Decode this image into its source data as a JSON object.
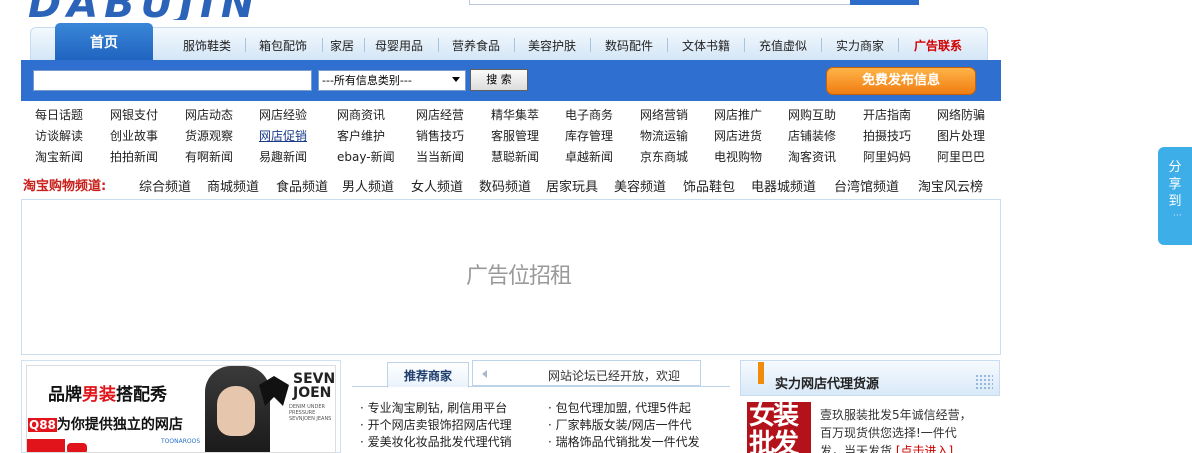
{
  "header": {
    "logo_text": "DABUJIN"
  },
  "nav": {
    "home": "首页",
    "items": [
      "服饰鞋类",
      "箱包配饰",
      "家居",
      "母婴用品",
      "营养食品",
      "美容护肤",
      "数码配件",
      "文体书籍",
      "充值虚似",
      "实力商家"
    ],
    "ad_contact": "广告联系"
  },
  "search": {
    "keyword_value": "",
    "category_selected": "---所有信息类别---",
    "button_label": "搜 索",
    "publish_label": "免费发布信息"
  },
  "link_grid": [
    [
      "每日话题",
      "网银支付",
      "网店动态",
      "网店经验",
      "网商资讯",
      "网店经营",
      "精华集萃",
      "电子商务",
      "网络营销",
      "网店推广",
      "网购互助",
      "开店指南",
      "网络防骗"
    ],
    [
      "访谈解读",
      "创业故事",
      "货源观察",
      "网店促销",
      "客户维护",
      "销售技巧",
      "客服管理",
      "库存管理",
      "物流运输",
      "网店进货",
      "店铺装修",
      "拍摄技巧",
      "图片处理"
    ],
    [
      "淘宝新闻",
      "拍拍新闻",
      "有啊新闻",
      "易趣新闻",
      "ebay-新闻",
      "当当新闻",
      "慧聪新闻",
      "卓越新闻",
      "京东商城",
      "电视购物",
      "淘客资讯",
      "阿里妈妈",
      "阿里巴巴"
    ]
  ],
  "taobao": {
    "label": "淘宝购物频道:",
    "channels": [
      "综合频道",
      "商城频道",
      "食品频道",
      "男人频道",
      "女人频道",
      "数码频道",
      "居家玩具",
      "美容频道",
      "饰品鞋包",
      "电器城频道",
      "台湾馆频道",
      "淘宝风云榜"
    ]
  },
  "ad": {
    "text": "广告位招租"
  },
  "banner": {
    "line1_a": "品牌",
    "line1_b": "男装",
    "line1_c": "搭配秀",
    "qq": "Q88",
    "line2": "为你提供独立的网店",
    "brand": "SEVN\nJOEN",
    "brand_sub": "DENIM UNDER PRESSURE SEVNJOEN JEANS",
    "toona": "TOONAROOS"
  },
  "recommend": {
    "tab": "推荐商家",
    "notice": "网站论坛已经开放，欢迎",
    "left_items": [
      "· 专业淘宝刷钻, 刷信用平台",
      "· 开个网店卖银饰招网店代理",
      "· 爱美妆化妆品批发代理代销"
    ],
    "right_items": [
      "· 包包代理加盟, 代理5件起",
      "· 厂家韩版女装/网店一件代",
      "· 瑞格饰品代销批发一件代发"
    ]
  },
  "agency": {
    "title": "实力网店代理货源",
    "image_text": "女装\n批发",
    "desc": "壹玖服装批发5年诚信经营，百万现货供您选择!一件代发，当天发货",
    "more": "[点击进入]"
  },
  "share": {
    "label": "分享到",
    "dots": "···"
  }
}
